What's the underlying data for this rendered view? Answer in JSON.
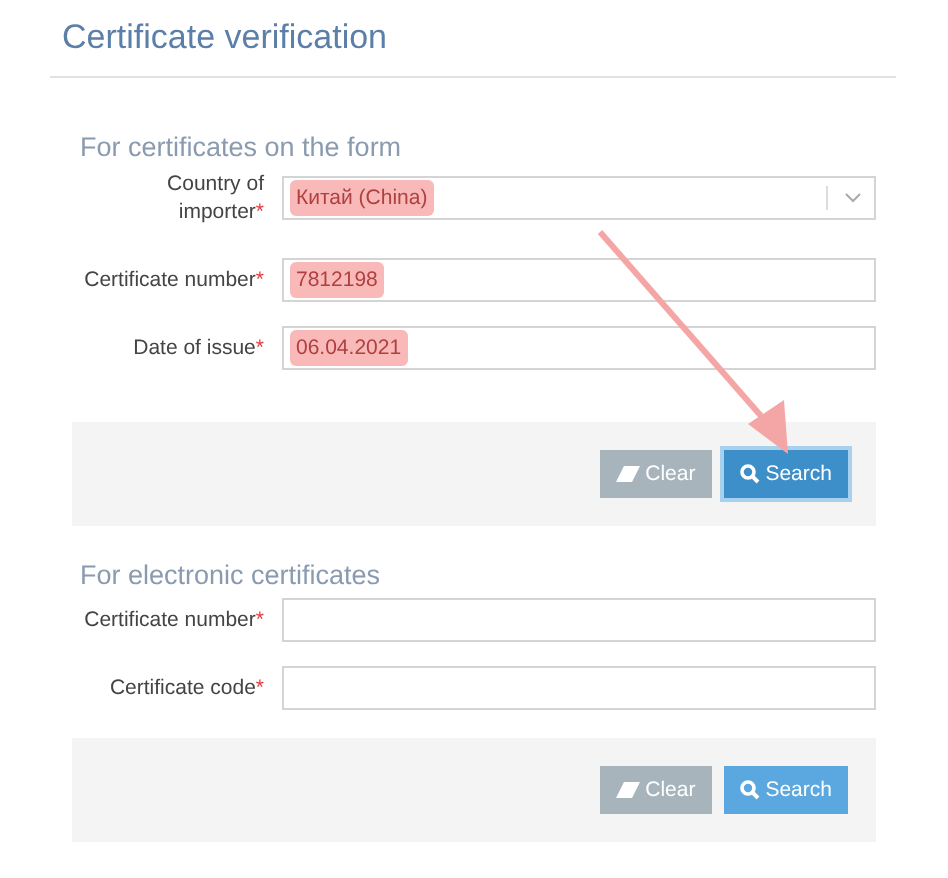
{
  "title": "Certificate verification",
  "sections": [
    {
      "heading": "For certificates on the form",
      "fields": [
        {
          "label": "Country of importer",
          "required_mark": "*",
          "kind": "select",
          "value": "Китай (China)",
          "highlighted": true
        },
        {
          "label": "Certificate number",
          "required_mark": "*",
          "kind": "text",
          "value": "7812198",
          "highlighted": true
        },
        {
          "label": "Date of issue",
          "required_mark": "*",
          "kind": "text",
          "value": "06.04.2021",
          "highlighted": true
        }
      ],
      "buttons": [
        {
          "label": "Clear",
          "kind": "clear",
          "highlighted": false
        },
        {
          "label": "Search",
          "kind": "search",
          "highlighted": true
        }
      ]
    },
    {
      "heading": "For electronic certificates",
      "fields": [
        {
          "label": "Certificate number",
          "required_mark": "*",
          "kind": "text"
        },
        {
          "label": "Certificate code",
          "required_mark": "*",
          "kind": "text"
        }
      ],
      "buttons": [
        {
          "label": "Clear",
          "kind": "clear",
          "highlighted": false
        },
        {
          "label": "Search",
          "kind": "search",
          "highlighted": false
        }
      ]
    }
  ]
}
